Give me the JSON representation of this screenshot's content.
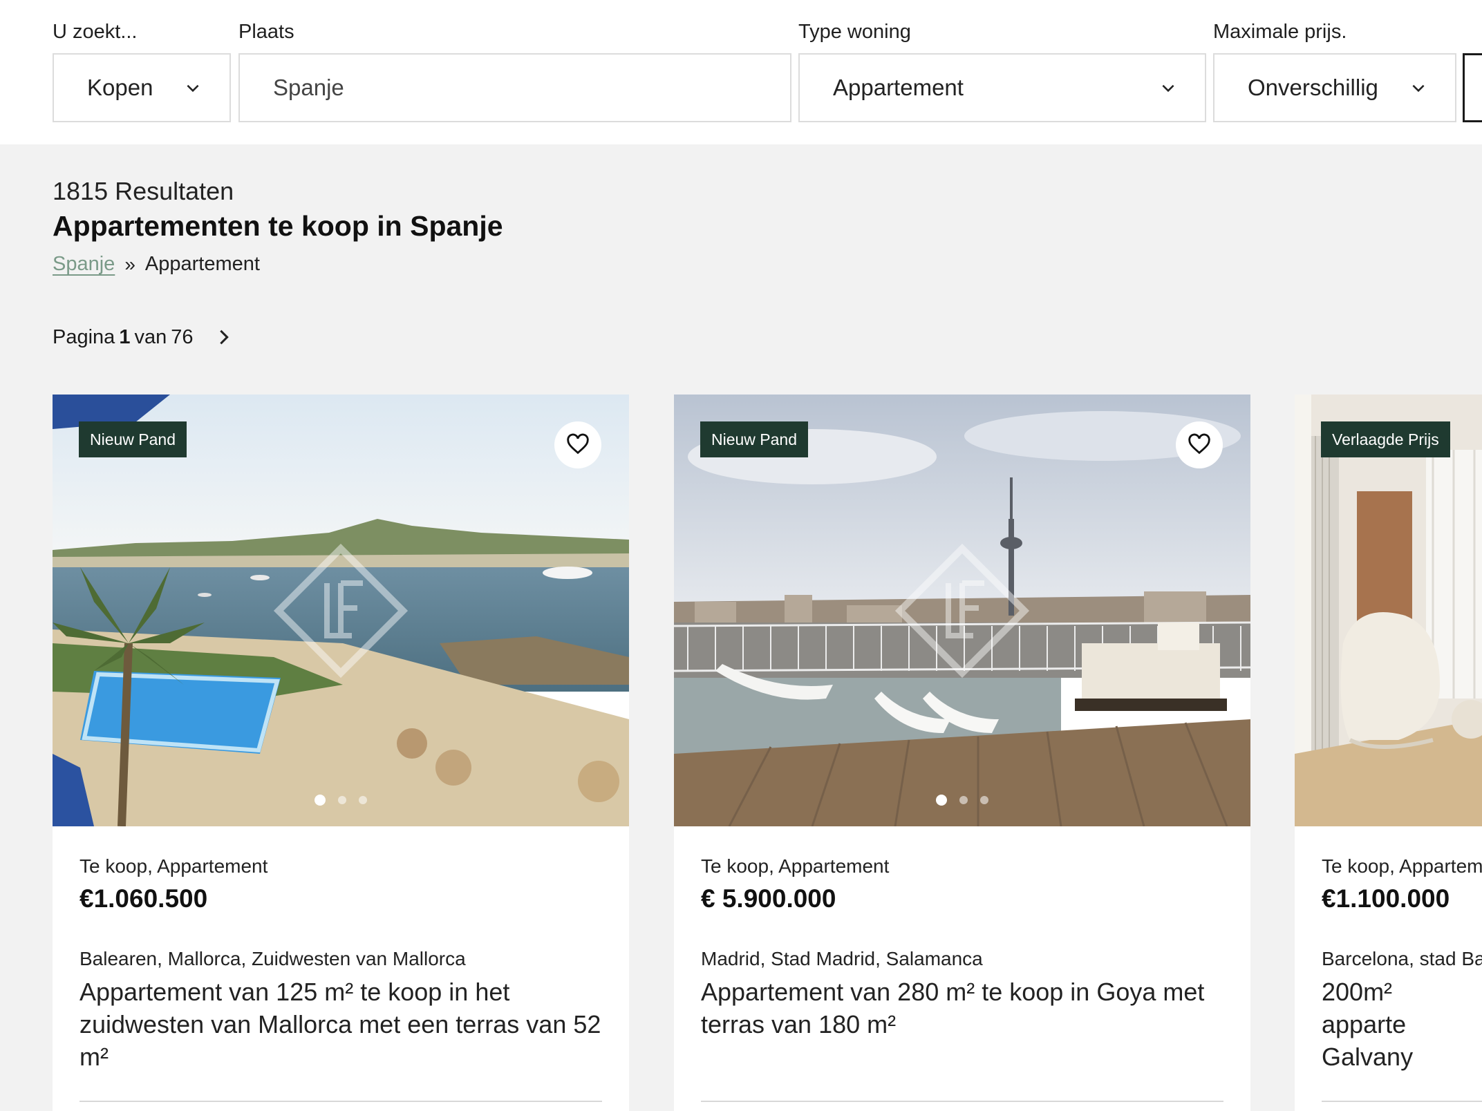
{
  "search": {
    "mode_label": "U zoekt...",
    "mode_value": "Kopen",
    "place_label": "Plaats",
    "place_value": "Spanje",
    "type_label": "Type woning",
    "type_value": "Appartement",
    "price_label": "Maximale prijs.",
    "price_value": "Onverschillig"
  },
  "results": {
    "count": "1815 Resultaten",
    "heading": "Appartementen te koop in Spanje",
    "breadcrumb": {
      "link": "Spanje",
      "separator": "»",
      "current": "Appartement"
    },
    "pagination": {
      "prefix": "Pagina",
      "current": "1",
      "middle": "van",
      "total": "76"
    }
  },
  "cards": [
    {
      "badge": "Nieuw Pand",
      "type": "Te koop, Appartement",
      "price": "€1.060.500",
      "location": "Balearen, Mallorca, Zuidwesten van Mallorca",
      "title": "Appartement van 125 m² te koop in het zuidwesten van Mallorca met een terras van 52 m²"
    },
    {
      "badge": "Nieuw Pand",
      "type": "Te koop, Appartement",
      "price": "€ 5.900.000",
      "location": "Madrid, Stad Madrid, Salamanca",
      "title": "Appartement van 280 m² te koop in Goya met terras van 180 m²"
    },
    {
      "badge": "Verlaagde Prijs",
      "type": "Te koop, Appartem",
      "price": "€1.100.000",
      "location": "Barcelona, stad Ba",
      "title": "200m² apparte Galvany"
    }
  ],
  "colors": {
    "badge_bg": "#1f3a30",
    "breadcrumb_link": "#7a9a88",
    "page_bg": "#f2f2f2"
  },
  "icons": [
    "chevron-down-icon",
    "chevron-right-icon",
    "heart-icon"
  ]
}
